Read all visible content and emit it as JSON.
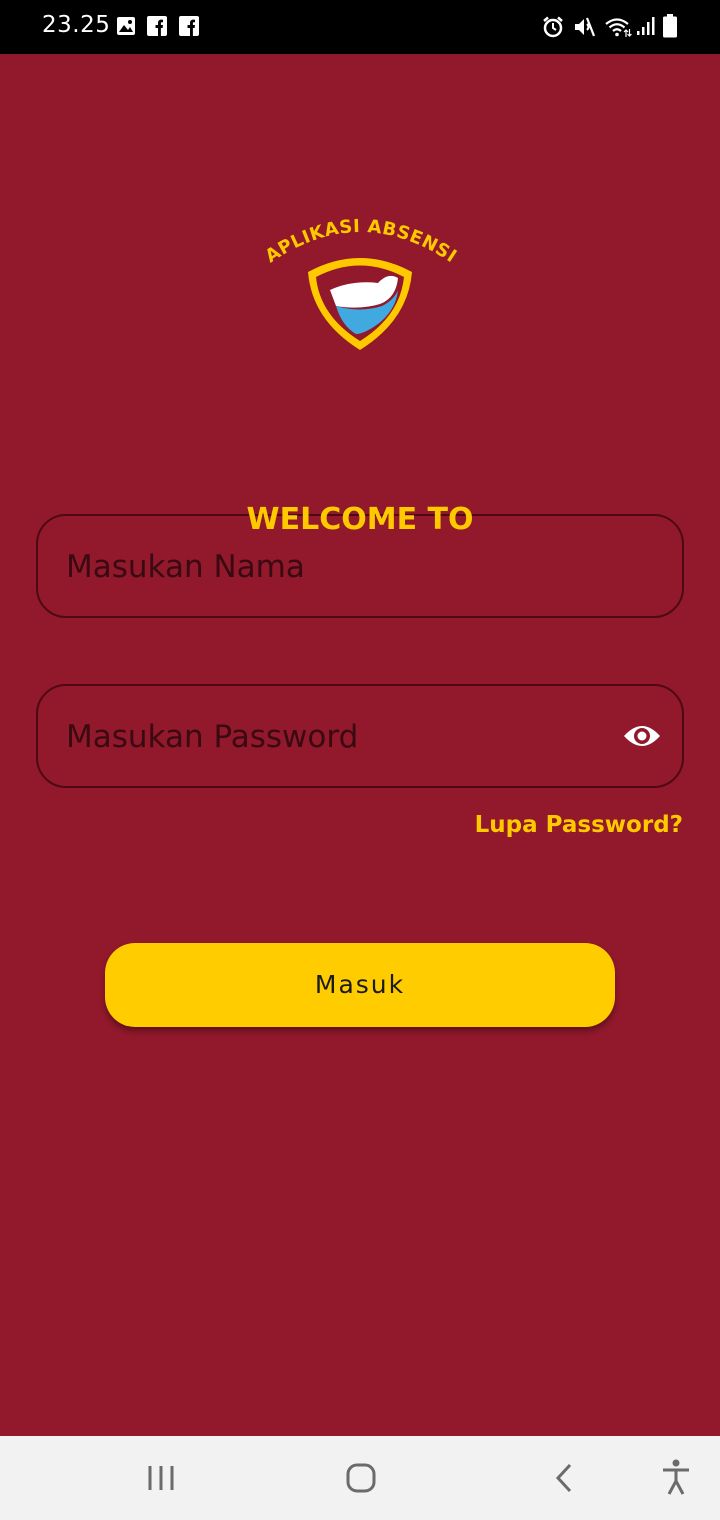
{
  "status_bar": {
    "time": "23.25",
    "icons": [
      "image-icon",
      "facebook-icon",
      "facebook-icon",
      "alarm-icon",
      "mute-icon",
      "wifi-icon",
      "signal-icon",
      "battery-icon"
    ]
  },
  "logo": {
    "text": "APLIKASI ABSENSI",
    "colors": {
      "shield_border": "#FFC900",
      "shield_dark": "#92182B",
      "white_band": "#FFFFFF",
      "blue_band": "#3FA9E0"
    }
  },
  "welcome": {
    "text": "WELCOME TO"
  },
  "form": {
    "name_placeholder": "Masukan Nama",
    "password_placeholder": "Masukan Password",
    "forgot_password": "Lupa Password?",
    "login_label": "Masuk"
  },
  "colors": {
    "background": "#92182B",
    "accent": "#FFC900",
    "button": "#FFCC00"
  },
  "nav_bar": {
    "buttons": [
      "recent-apps-icon",
      "home-icon",
      "back-icon",
      "accessibility-icon"
    ]
  }
}
